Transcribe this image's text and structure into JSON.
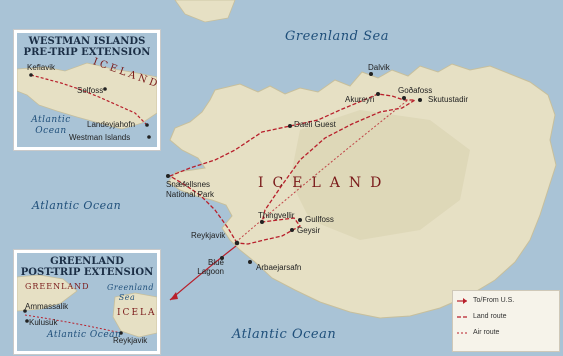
{
  "oceans": {
    "greenland_sea": "Greenland Sea",
    "atlantic_main": "Atlantic Ocean",
    "atlantic_south": "Atlantic Ocean"
  },
  "country": "ICELAND",
  "places": {
    "dalvik": "Dalvik",
    "akureyri": "Akureyri",
    "godafoss": "Goðafoss",
    "skutustadir": "Skutustadir",
    "daeli": "Daeli Guest",
    "snaefellsnes": "Snæfellsnes National Park",
    "thingvellir": "Thingvellir",
    "gullfoss": "Gullfoss",
    "geysir": "Geysir",
    "reykjavik": "Reykjavik",
    "blue_lagoon": "Blue Lagoon",
    "arbaejarsafn": "Arbaejarsafn"
  },
  "inset_top": {
    "title_line1": "WESTMAN ISLANDS",
    "title_line2": "PRE-TRIP EXTENSION",
    "country": "ICELAND",
    "ocean": "Atlantic Ocean",
    "places": {
      "keflavik": "Keflavik",
      "selfoss": "Selfoss",
      "landeyjahofn": "Landeyjahofn",
      "westman": "Westman Islands"
    }
  },
  "inset_bottom": {
    "title_line1": "GREENLAND",
    "title_line2": "POST-TRIP EXTENSION",
    "greenland": "GREENLAND",
    "iceland": "ICELAND",
    "sea": "Greenland Sea",
    "ocean": "Atlantic Ocean",
    "places": {
      "ammassalik": "Ammassalik",
      "kulusuk": "Kulusuk",
      "reykjavik": "Reykjavik"
    }
  },
  "legend": {
    "to_from": "To/From U.S.",
    "land_route": "Land route",
    "air_route": "Air route"
  },
  "colors": {
    "water": "#a9c3d6",
    "land": "#e6e0c4",
    "route": "#b81f2b",
    "text": "#222222",
    "ocean_text": "#1f4f7a"
  }
}
